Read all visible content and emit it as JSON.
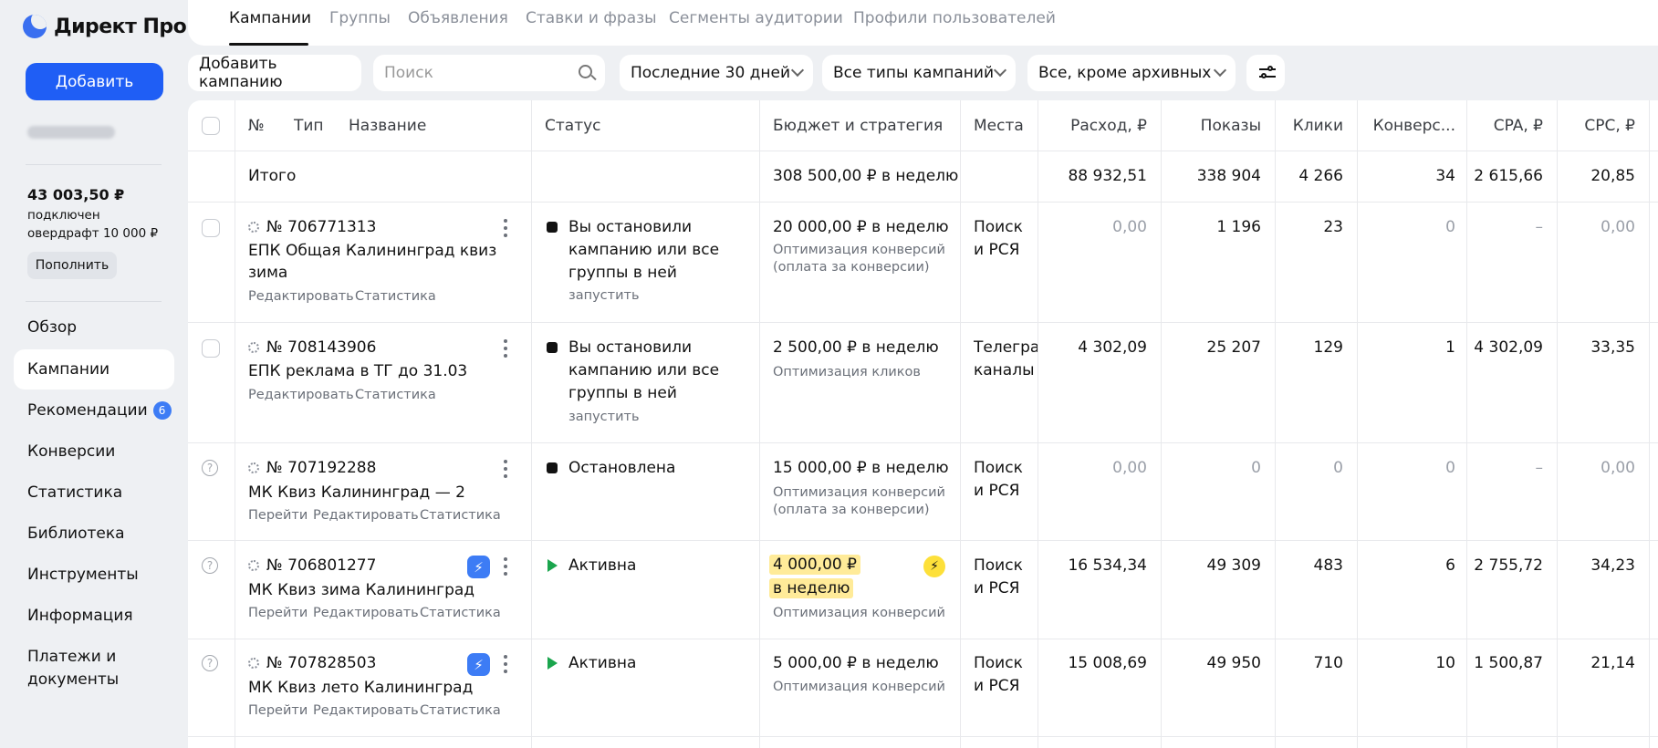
{
  "app": {
    "logo_text": "Директ Про"
  },
  "sidebar": {
    "add_label": "Добавить",
    "balance": "43 003,50 ₽",
    "overdraft": "подключен овердрафт 10 000 ₽",
    "topup_label": "Пополнить",
    "nav": [
      {
        "label": "Обзор"
      },
      {
        "label": "Кампании"
      },
      {
        "label": "Рекомендации",
        "badge": "6"
      },
      {
        "label": "Конверсии"
      },
      {
        "label": "Статистика"
      },
      {
        "label": "Библиотека"
      },
      {
        "label": "Инструменты"
      },
      {
        "label": "Информация"
      },
      {
        "label": "Платежи и документы"
      }
    ]
  },
  "tabs": [
    "Кампании",
    "Группы",
    "Объявления",
    "Ставки и фразы",
    "Сегменты аудитории",
    "Профили пользователей"
  ],
  "toolbar": {
    "add_campaign": "Добавить кампанию",
    "search_placeholder": "Поиск",
    "period": "Последние 30 дней",
    "types": "Все типы кампаний",
    "archive": "Все, кроме архивных"
  },
  "table": {
    "headers": {
      "number": "№",
      "type": "Тип",
      "name": "Название",
      "status": "Статус",
      "budget": "Бюджет и стратегия",
      "places": "Места",
      "spend": "Расход, ₽",
      "impressions": "Показы",
      "clicks": "Клики",
      "conversions": "Конверс...",
      "cpa": "CPA, ₽",
      "cpc": "CPC, ₽"
    },
    "total": {
      "label": "Итого",
      "budget": "308 500,00 ₽ в неделю",
      "spend": "88 932,51",
      "impressions": "338 904",
      "clicks": "4 266",
      "conversions": "34",
      "cpa": "2 615,66",
      "cpc": "20,85"
    },
    "rows": [
      {
        "id": "№ 706771313",
        "name_l1": "ЕПК Общая Калининград квиз",
        "name_l2": "зима",
        "links": [
          "Редактировать",
          "Статистика"
        ],
        "status_l1": "Вы остановили",
        "status_l2": "кампанию или все",
        "status_l3": "группы в ней",
        "status_action": "запустить",
        "budget": "20 000,00 ₽ в неделю",
        "strategy_l1": "Оптимизация конверсий",
        "strategy_l2": "(оплата за конверсии)",
        "places_l1": "Поиск",
        "places_l2": "и РСЯ",
        "spend": "0,00",
        "impressions": "1 196",
        "clicks": "23",
        "conversions": "0",
        "cpa": "–",
        "cpc": "0,00"
      },
      {
        "id": "№ 708143906",
        "name_l1": "ЕПК реклама в ТГ до 31.03",
        "links": [
          "Редактировать",
          "Статистика"
        ],
        "status_l1": "Вы остановили",
        "status_l2": "кампанию или все",
        "status_l3": "группы в ней",
        "status_action": "запустить",
        "budget": "2 500,00 ₽ в неделю",
        "strategy_l1": "Оптимизация кликов",
        "places_l1": "Телегра",
        "places_l2": "каналы",
        "spend": "4 302,09",
        "impressions": "25 207",
        "clicks": "129",
        "conversions": "1",
        "cpa": "4 302,09",
        "cpc": "33,35"
      },
      {
        "id": "№ 707192288",
        "name_l1": "МК Квиз Калининград — 2",
        "links": [
          "Перейти",
          "Редактировать",
          "Статистика"
        ],
        "status_l1": "Остановлена",
        "budget": "15 000,00 ₽ в неделю",
        "strategy_l1": "Оптимизация конверсий",
        "strategy_l2": "(оплата за конверсии)",
        "places_l1": "Поиск",
        "places_l2": "и РСЯ",
        "spend": "0,00",
        "impressions": "0",
        "clicks": "0",
        "conversions": "0",
        "cpa": "–",
        "cpc": "0,00"
      },
      {
        "id": "№ 706801277",
        "name_l1": "МК Квиз зима Калининград",
        "links": [
          "Перейти",
          "Редактировать",
          "Статистика"
        ],
        "status_l1": "Активна",
        "budget_l1": "4 000,00 ₽",
        "budget_l2": "в неделю",
        "strategy_l1": "Оптимизация конверсий",
        "places_l1": "Поиск",
        "places_l2": "и РСЯ",
        "spend": "16 534,34",
        "impressions": "49 309",
        "clicks": "483",
        "conversions": "6",
        "cpa": "2 755,72",
        "cpc": "34,23"
      },
      {
        "id": "№ 707828503",
        "name_l1": "МК Квиз лето Калининград",
        "links": [
          "Перейти",
          "Редактировать",
          "Статистика"
        ],
        "status_l1": "Активна",
        "budget": "5 000,00 ₽ в неделю",
        "strategy_l1": "Оптимизация конверсий",
        "places_l1": "Поиск",
        "places_l2": "и РСЯ",
        "spend": "15 008,69",
        "impressions": "49 950",
        "clicks": "710",
        "conversions": "10",
        "cpa": "1 500,87",
        "cpc": "21,14"
      }
    ]
  },
  "colors": {
    "accent": "#1f5ef5",
    "active_green": "#1aa54d",
    "highlight": "#ffeb99"
  }
}
